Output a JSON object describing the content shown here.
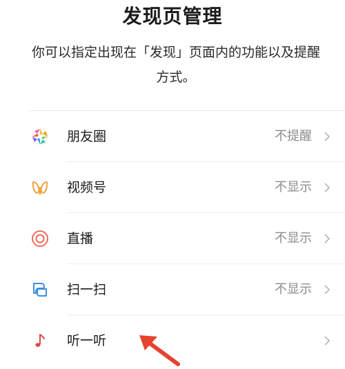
{
  "page": {
    "title": "发现页管理",
    "description": "你可以指定出现在「发现」页面内的功能以及提醒方式。"
  },
  "items": [
    {
      "label": "朋友圈",
      "value": "不提醒",
      "icon": "moments-aperture-icon"
    },
    {
      "label": "视频号",
      "value": "不显示",
      "icon": "channels-butterfly-icon"
    },
    {
      "label": "直播",
      "value": "不显示",
      "icon": "live-circle-icon"
    },
    {
      "label": "扫一扫",
      "value": "不显示",
      "icon": "scan-icon"
    },
    {
      "label": "听一听",
      "value": "",
      "icon": "music-note-icon"
    }
  ],
  "colors": {
    "label": "#1a1a1a",
    "value": "#8c8c8c",
    "divider": "#ececec",
    "arrow": "#e5432f"
  }
}
